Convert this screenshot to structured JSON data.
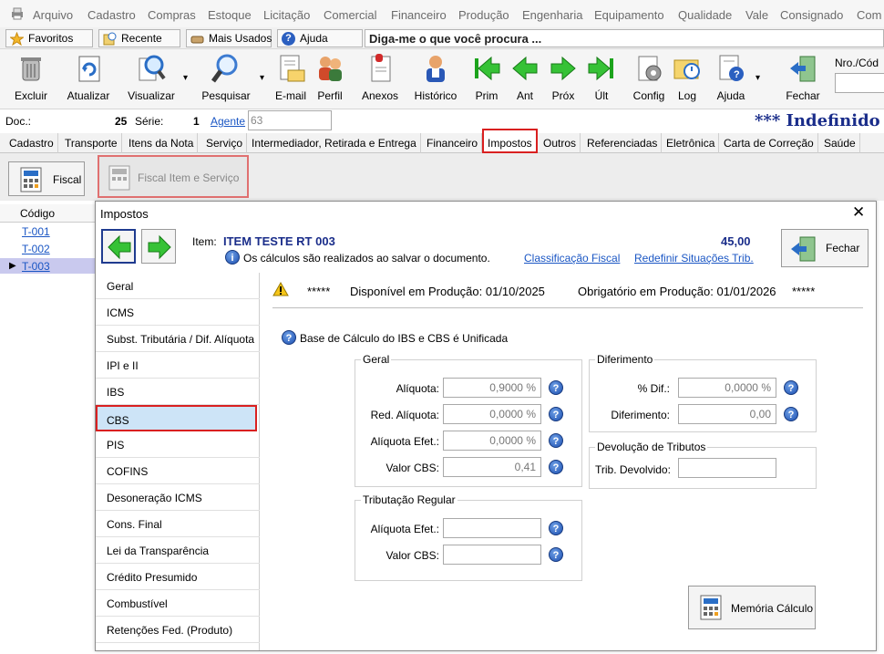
{
  "menu": [
    "Arquivo",
    "Cadastro",
    "Compras",
    "Estoque",
    "Licitação",
    "Comercial",
    "Financeiro",
    "Produção",
    "Engenharia",
    "Equipamento",
    "Qualidade",
    "Vale",
    "Consignado",
    "Com"
  ],
  "quick": {
    "favoritos": "Favoritos",
    "recente": "Recente",
    "mais_usados": "Mais Usados",
    "ajuda": "Ajuda",
    "search_placeholder": "Diga-me o que você procura ..."
  },
  "toolbar": {
    "excluir": "Excluir",
    "atualizar": "Atualizar",
    "visualizar": "Visualizar",
    "pesquisar": "Pesquisar",
    "email": "E-mail",
    "perfil": "Perfil",
    "anexos": "Anexos",
    "historico": "Histórico",
    "prim": "Prim",
    "ant": "Ant",
    "prox": "Próx",
    "ult": "Últ",
    "config": "Config",
    "log": "Log",
    "ajuda": "Ajuda",
    "fechar": "Fechar",
    "nro_label": "Nro./Cód"
  },
  "doc": {
    "label": "Doc.:",
    "number": "25",
    "serie_label": "Série:",
    "serie": "1",
    "agente_label": "Agente",
    "agente_value": "63",
    "status": "*** Indefinido *"
  },
  "tabs": [
    "Cadastro",
    "Transporte",
    "Itens da Nota",
    "Serviço",
    "Intermediador, Retirada e Entrega",
    "Financeiro",
    "Impostos",
    "Outros",
    "Referenciadas",
    "Eletrônica",
    "Carta de Correção",
    "Saúde"
  ],
  "subbar": {
    "fiscal": "Fiscal",
    "fiscal_item": "Fiscal Item e Serviço"
  },
  "grid": {
    "header": "Código",
    "rows": [
      "T-001",
      "T-002",
      "T-003"
    ]
  },
  "modal": {
    "title": "Impostos",
    "item_label": "Item:",
    "item_name": "ITEM TESTE RT 003",
    "item_value": "45,00",
    "info": "Os cálculos são realizados ao salvar o documento.",
    "link_classificacao": "Classificação Fiscal",
    "link_redefinir": "Redefinir Situações Trib.",
    "fechar": "Fechar",
    "nav": [
      "Geral",
      "ICMS",
      "Subst. Tributária / Dif. Alíquota",
      "IPI e II",
      "IBS",
      "CBS",
      "PIS",
      "COFINS",
      "Desoneração ICMS",
      "Cons. Final",
      "Lei da Transparência",
      "Crédito Presumido",
      "Combustível",
      "Retenções Fed. (Produto)"
    ],
    "warning_prefix": "*****",
    "warning_disp": "Disponível em Produção: 01/10/2025",
    "warning_obrig": "Obrigatório em Produção: 01/01/2026",
    "warning_suffix": "*****",
    "base_info": "Base de Cálculo do IBS e CBS é Unificada",
    "geral": {
      "title": "Geral",
      "aliquota_label": "Alíquota:",
      "aliquota": "0,9000 %",
      "red_label": "Red. Alíquota:",
      "red": "0,0000 %",
      "efet_label": "Alíquota Efet.:",
      "efet": "0,0000 %",
      "valor_label": "Valor CBS:",
      "valor": "0,41"
    },
    "diferimento": {
      "title": "Diferimento",
      "pct_label": "% Dif.:",
      "pct": "0,0000 %",
      "dif_label": "Diferimento:",
      "dif": "0,00"
    },
    "devolucao": {
      "title": "Devolução de Tributos",
      "trib_label": "Trib. Devolvido:",
      "trib": ""
    },
    "regular": {
      "title": "Tributação Regular",
      "efet_label": "Alíquota Efet.:",
      "efet": "",
      "valor_label": "Valor CBS:",
      "valor": ""
    },
    "memoria": "Memória Cálculo"
  }
}
